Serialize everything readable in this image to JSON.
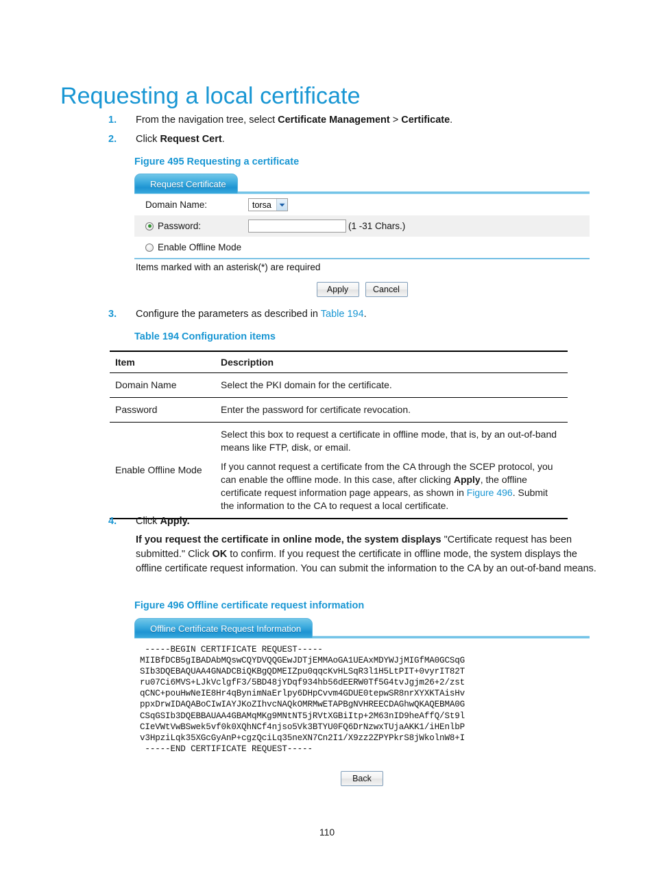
{
  "page": {
    "title": "Requesting a local certificate",
    "number": "110"
  },
  "steps": [
    {
      "num": "1.",
      "text_prefix": "From the navigation tree, select ",
      "bold1": "Certificate Management",
      "mid": " > ",
      "bold2": "Certificate",
      "suffix": "."
    },
    {
      "num": "2.",
      "text_prefix": "Click ",
      "bold1": "Request Cert",
      "suffix": "."
    },
    {
      "num": "3.",
      "text_prefix": "Configure the parameters as described in ",
      "link": "Table 194",
      "suffix": "."
    },
    {
      "num": "4.",
      "text_prefix": "Click ",
      "bold1": "Apply.",
      "suffix": ""
    }
  ],
  "figure495": {
    "caption": "Figure 495 Requesting a certificate",
    "tab_label": "Request Certificate",
    "domain_label": "Domain Name:",
    "domain_value": "torsa",
    "password_label": "Password:",
    "password_value": "",
    "password_hint": "(1 -31 Chars.)",
    "offline_label": "Enable Offline Mode",
    "asterisk_note": "Items marked with an asterisk(*) are required",
    "apply_label": "Apply",
    "cancel_label": "Cancel"
  },
  "table194": {
    "caption": "Table 194 Configuration items",
    "headers": [
      "Item",
      "Description"
    ],
    "rows": [
      {
        "item": "Domain Name",
        "paras": [
          "Select the PKI domain for the certificate."
        ]
      },
      {
        "item": "Password",
        "paras": [
          "Enter the password for certificate revocation."
        ]
      },
      {
        "item": "Enable Offline Mode",
        "paras": [
          "Select this box to request a certificate in offline mode, that is, by an out-of-band means like FTP, disk, or email.",
          "If you cannot request a certificate from the CA through the SCEP protocol, you can enable the offline mode. In this case, after clicking Apply, the offline certificate request information page appears, as shown in Figure 496. Submit the information to the CA to request a local certificate."
        ],
        "para2_bold": "Apply",
        "para2_link": "Figure 496"
      }
    ]
  },
  "step4_paragraph": {
    "bold_lead": "If you request the certificate in online mode, the system displays",
    "rest_a": " \"Certificate request has been submitted.\" Click ",
    "bold_ok": "OK",
    "rest_b": " to confirm. If you request the certificate in offline mode, the system displays the offline certificate request information. You can submit the information to the CA by an out-of-band means."
  },
  "figure496": {
    "caption": "Figure 496 Offline certificate request information",
    "tab_label": "Offline Certificate Request Information",
    "back_label": "Back",
    "certificate_text": " -----BEGIN CERTIFICATE REQUEST-----\nMIIBfDCB5gIBADAbMQswCQYDVQQGEwJDTjEMMAoGA1UEAxMDYWJjMIGfMA0GCSqG\nSIb3DQEBAQUAA4GNADCBiQKBgQDMEIZpu0qqcKvHLSqR3l1H5LtPIT+0vyrIT82T\nru07Ci6MVS+LJkVclgfF3/5BD48jYDqf934hb56dEERW0Tf5G4tvJgjm26+2/zst\nqCNC+pouHwNeIE8Hr4qBynimNaErlpy6DHpCvvm4GDUE0tepwSR8nrXYXKTAisHv\nppxDrwIDAQABoCIwIAYJKoZIhvcNAQkOMRMwETAPBgNVHREECDAGhwQKAQEBMA0G\nCSqGSIb3DQEBBAUAA4GBAMqMKg9MNtNT5jRVtXGBiItp+2M63nID9heAffQ/St9l\nCIeVWtVwBSwek5vf0k0XQhNCf4njso5Vk3BTYU0FQ6DrNzwxTUjaAKK1/iHEnlbP\nv3HpziLqk35XGcGyAnP+cgzQciLq35neXN7Cn2I1/X9zz2ZPYPkrS8jWkolnW8+I\n -----END CERTIFICATE REQUEST-----"
  }
}
